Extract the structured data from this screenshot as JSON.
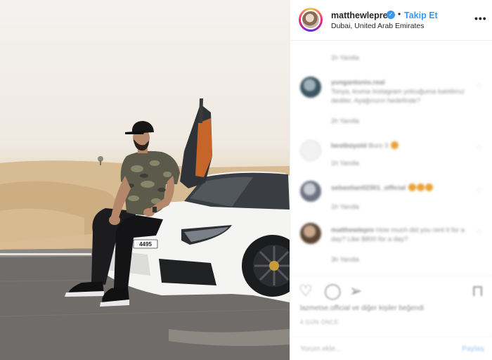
{
  "post": {
    "username": "matthewlepre",
    "verified_icon": "verified-badge-icon",
    "separator": "•",
    "follow_label": "Takip Et",
    "location": "Dubai, United Arab Emirates",
    "more_label": "•••",
    "license_plate": "4495"
  },
  "colors": {
    "accent": "#3897f0",
    "text": "#262626",
    "muted": "#8e8e8e"
  },
  "comments": [
    {
      "meta": "1h   Yanıtla"
    },
    {
      "author": "yungantonio.real",
      "text": "Tonya, kıvma Instagram yolcuğuma katıldınız dediler. Ayağınızın hedefinde?",
      "meta": "2h   Yanıtla"
    },
    {
      "author": "bestboyold",
      "text": "Buro 3",
      "meta": "1h   Yanıtla"
    },
    {
      "author": "sebastian02301_official",
      "text": "",
      "meta": "1h   Yanıtla"
    },
    {
      "author": "matthewlepre",
      "text": "How much did you rent it for a day? Like $800 for a day?",
      "meta": "3h   Yanıtla"
    }
  ],
  "actions": {
    "like_icon": "heart-icon",
    "comment_icon": "comment-icon",
    "share_icon": "share-icon",
    "save_icon": "bookmark-icon"
  },
  "likes_text": "lazmetse.official ve diğer kişiler beğendi",
  "timestamp": "4 GÜN ÖNCE",
  "comment_input": {
    "placeholder": "Yorum ekle...",
    "post_label": "Paylaş"
  }
}
